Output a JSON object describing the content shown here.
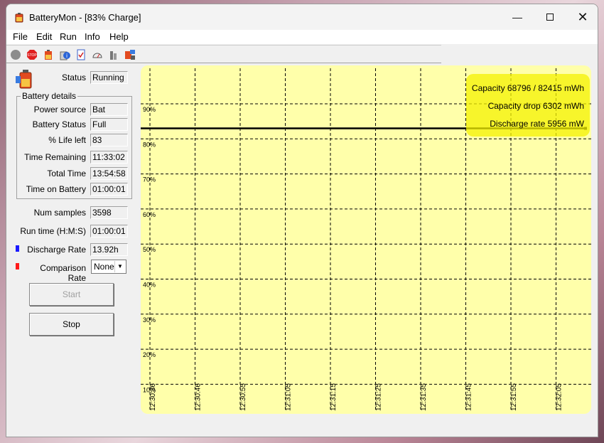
{
  "window": {
    "title": "BatteryMon - [83% Charge]"
  },
  "menu": [
    "File",
    "Edit",
    "Run",
    "Info",
    "Help"
  ],
  "toolbar": [
    "record-icon",
    "stop-sign-icon",
    "battery-icon",
    "info-icon",
    "checklist-icon",
    "gauge-icon",
    "chart-icon",
    "config-icon"
  ],
  "status": {
    "label": "Status",
    "value": "Running"
  },
  "battery_details": {
    "title": "Battery details",
    "rows": [
      {
        "label": "Power source",
        "value": "Bat"
      },
      {
        "label": "Battery Status",
        "value": "Full"
      },
      {
        "label": "% Life left",
        "value": "83"
      },
      {
        "label": "Time Remaining",
        "value": "11:33:02"
      },
      {
        "label": "Total Time",
        "value": "13:54:58"
      },
      {
        "label": "Time on Battery",
        "value": "01:00:01"
      }
    ]
  },
  "stats": {
    "num_samples": {
      "label": "Num samples",
      "value": "3598"
    },
    "run_time": {
      "label": "Run time (H:M:S)",
      "value": "01:00:01"
    },
    "discharge": {
      "label": "Discharge Rate",
      "value": "13.92h",
      "color": "#1a1aff"
    },
    "comparison": {
      "label": "Comparison Rate",
      "value": "None",
      "color": "#ff1a1a"
    }
  },
  "buttons": {
    "start": "Start",
    "stop": "Stop"
  },
  "chart_data": {
    "type": "line",
    "y_ticks": [
      "90%",
      "80%",
      "70%",
      "60%",
      "50%",
      "40%",
      "30%",
      "20%",
      "10%"
    ],
    "x_ticks": [
      "12:30:36",
      "12:30:46",
      "12:30:55",
      "12:31:05",
      "12:31:15",
      "12:31:25",
      "12:31:35",
      "12:31:45",
      "12:31:55",
      "12:32:05"
    ],
    "ylim": [
      10,
      90
    ],
    "grid": true,
    "series": [
      {
        "values": [
          83,
          83,
          83,
          83,
          83,
          83,
          83,
          83,
          83,
          83,
          83
        ]
      }
    ],
    "annotations": [
      "Capacity 68796 / 82415 mWh",
      "Capacity drop 6302 mWh",
      "Discharge rate 5956 mW"
    ],
    "colors": {
      "background": "#ffffaa",
      "line": "#000000",
      "highlight": "#f4f200"
    }
  }
}
